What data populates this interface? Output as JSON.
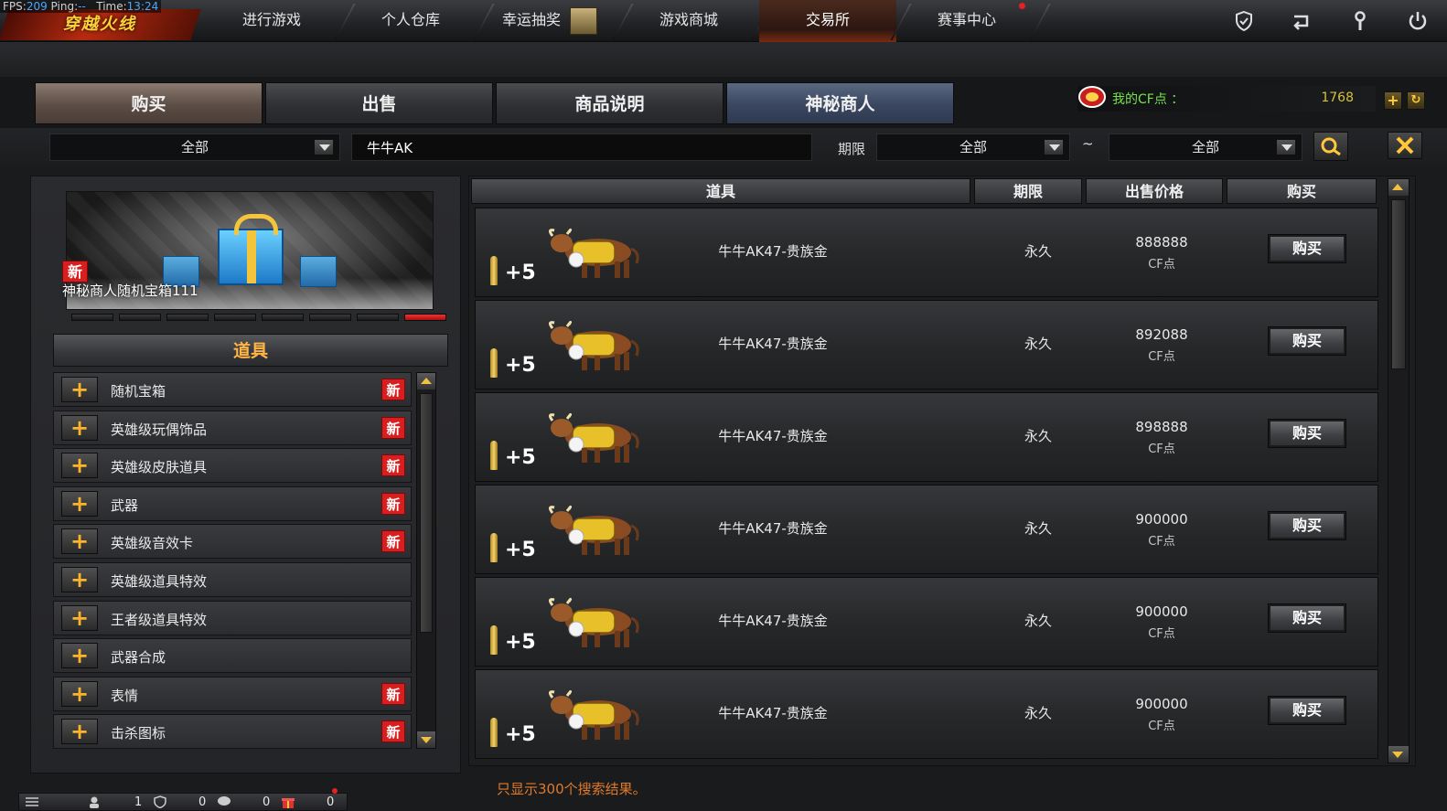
{
  "stats": {
    "fps_label": "FPS:",
    "fps": "209",
    "ping_label": "Ping:",
    "ping": "--",
    "time_label": "Time:",
    "time": "13:24"
  },
  "logo": {
    "text": "穿越火线"
  },
  "nav": {
    "tabs": [
      {
        "label": "进行游戏"
      },
      {
        "label": "个人仓库"
      },
      {
        "label": "幸运抽奖"
      },
      {
        "label": "游戏商城"
      },
      {
        "label": "交易所"
      },
      {
        "label": "赛事中心"
      }
    ],
    "icons": [
      "shield-check-icon",
      "return-icon",
      "tools-icon",
      "power-icon"
    ]
  },
  "content_tabs": [
    {
      "label": "购买"
    },
    {
      "label": "出售"
    },
    {
      "label": "商品说明"
    },
    {
      "label": "神秘商人"
    }
  ],
  "cf_points": {
    "label": "我的CF点 ：",
    "value": "1768"
  },
  "filters": {
    "category": "全部",
    "search_value": "牛牛AK",
    "term_label": "期限",
    "term_from": "全部",
    "tilde": "~",
    "term_to": "全部"
  },
  "banner": {
    "badge": "新",
    "title": "神秘商人随机宝箱111"
  },
  "category_header": "道具",
  "categories": [
    {
      "label": "随机宝箱",
      "new": "新"
    },
    {
      "label": "英雄级玩偶饰品",
      "new": "新"
    },
    {
      "label": "英雄级皮肤道具",
      "new": "新"
    },
    {
      "label": "武器",
      "new": "新"
    },
    {
      "label": "英雄级音效卡",
      "new": "新"
    },
    {
      "label": "英雄级道具特效",
      "new": ""
    },
    {
      "label": "王者级道具特效",
      "new": ""
    },
    {
      "label": "武器合成",
      "new": ""
    },
    {
      "label": "表情",
      "new": "新"
    },
    {
      "label": "击杀图标",
      "new": "新"
    }
  ],
  "table": {
    "headers": [
      "道具",
      "期限",
      "出售价格",
      "购买"
    ],
    "rows": [
      {
        "level": "+5",
        "name": "牛牛AK47-贵族金",
        "term": "永久",
        "price": "888888",
        "unit": "CF点",
        "buy": "购买"
      },
      {
        "level": "+5",
        "name": "牛牛AK47-贵族金",
        "term": "永久",
        "price": "892088",
        "unit": "CF点",
        "buy": "购买"
      },
      {
        "level": "+5",
        "name": "牛牛AK47-贵族金",
        "term": "永久",
        "price": "898888",
        "unit": "CF点",
        "buy": "购买"
      },
      {
        "level": "+5",
        "name": "牛牛AK47-贵族金",
        "term": "永久",
        "price": "900000",
        "unit": "CF点",
        "buy": "购买"
      },
      {
        "level": "+5",
        "name": "牛牛AK47-贵族金",
        "term": "永久",
        "price": "900000",
        "unit": "CF点",
        "buy": "购买"
      },
      {
        "level": "+5",
        "name": "牛牛AK47-贵族金",
        "term": "永久",
        "price": "900000",
        "unit": "CF点",
        "buy": "购买"
      }
    ]
  },
  "result_note": "只显示300个搜索结果。",
  "statusbar": {
    "friends": "1",
    "clan": "0",
    "chat": "0",
    "gift": "0"
  },
  "colors": {
    "accent_orange": "#ffb545",
    "cf_green": "#76e04e",
    "new_red": "#d81e1e",
    "note_orange": "#e07a2a"
  }
}
